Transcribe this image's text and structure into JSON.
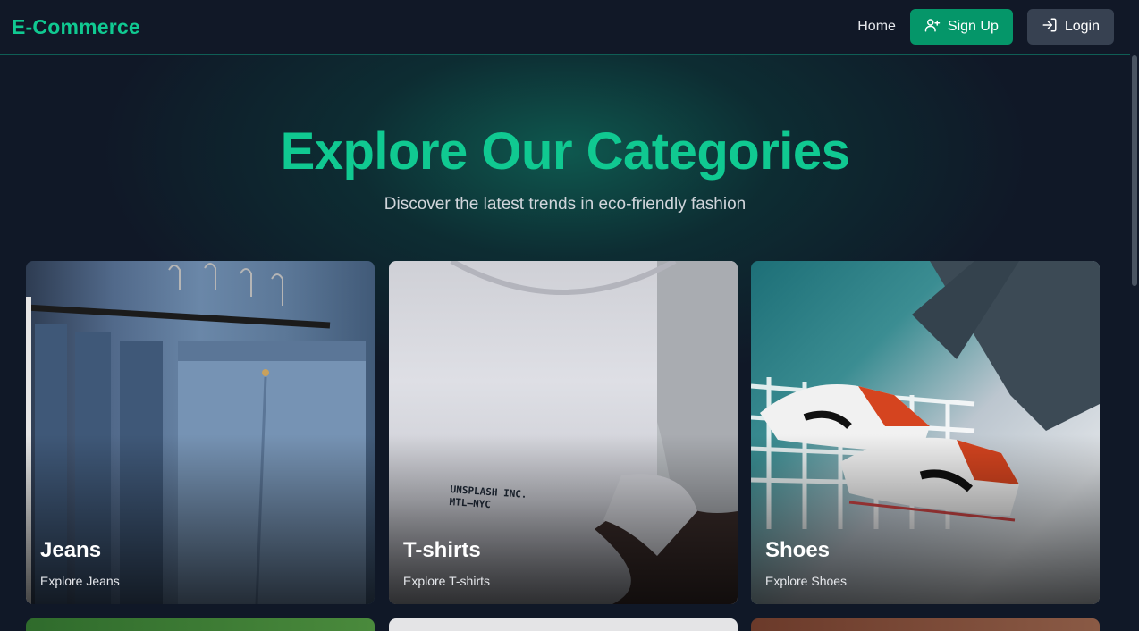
{
  "navbar": {
    "brand": "E-Commerce",
    "home_label": "Home",
    "signup_label": "Sign Up",
    "login_label": "Login",
    "signup_icon": "user-plus-icon",
    "login_icon": "log-in-icon"
  },
  "hero": {
    "title": "Explore Our Categories",
    "subtitle": "Discover the latest trends in eco-friendly fashion"
  },
  "categories": [
    {
      "title": "Jeans",
      "subtitle": "Explore Jeans"
    },
    {
      "title": "T-shirts",
      "subtitle": "Explore T-shirts",
      "image_text": "UNSPLASH INC.\nMTL—NYC"
    },
    {
      "title": "Shoes",
      "subtitle": "Explore Shoes"
    }
  ],
  "colors": {
    "accent": "#10c991",
    "signup_button": "#059669",
    "login_button": "#374151",
    "background": "#101827"
  }
}
